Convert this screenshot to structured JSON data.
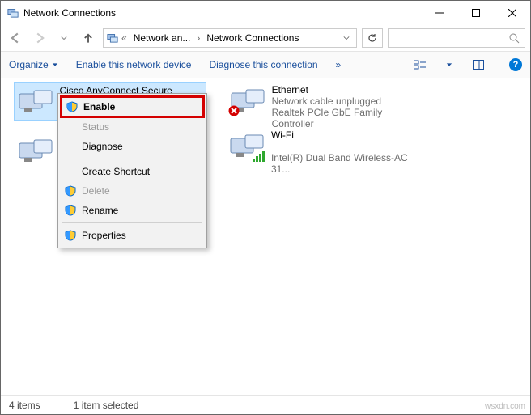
{
  "window": {
    "title": "Network Connections"
  },
  "breadcrumb": {
    "part1": "Network an...",
    "part2": "Network Connections"
  },
  "commands": {
    "organize": "Organize",
    "enable": "Enable this network device",
    "diagnose": "Diagnose this connection",
    "overflow": "»"
  },
  "adapters": {
    "cisco": {
      "name": "Cisco AnyConnect Secure Mobility"
    },
    "ethernet": {
      "name": "Ethernet",
      "status": "Network cable unplugged",
      "device": "Realtek PCIe GbE Family Controller"
    },
    "wifi": {
      "name": "Wi-Fi",
      "device": "Intel(R) Dual Band Wireless-AC 31..."
    }
  },
  "context_menu": {
    "enable": "Enable",
    "status": "Status",
    "diagnose": "Diagnose",
    "create_shortcut": "Create Shortcut",
    "delete": "Delete",
    "rename": "Rename",
    "properties": "Properties"
  },
  "status_bar": {
    "count": "4 items",
    "selected": "1 item selected"
  },
  "watermark": "wsxdn.com"
}
